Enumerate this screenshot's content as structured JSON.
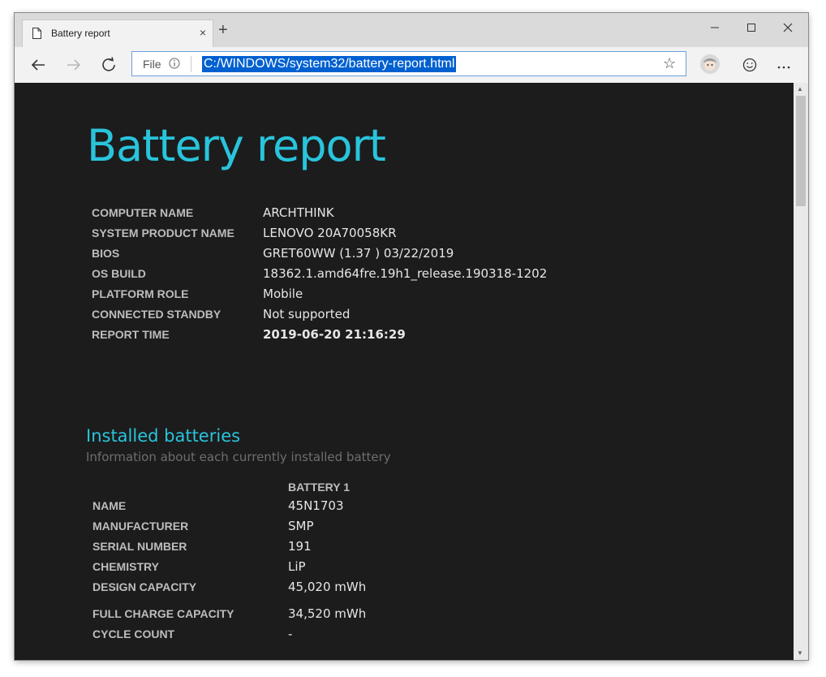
{
  "browser": {
    "tab_title": "Battery report",
    "tab_close": "×",
    "new_tab": "+",
    "address": {
      "scheme_label": "File",
      "url": "C:/WINDOWS/system32/battery-report.html"
    }
  },
  "report": {
    "title": "Battery report",
    "system_info": [
      {
        "label": "COMPUTER NAME",
        "value": "ARCHTHINK"
      },
      {
        "label": "SYSTEM PRODUCT NAME",
        "value": "LENOVO 20A70058KR"
      },
      {
        "label": "BIOS",
        "value": "GRET60WW (1.37 ) 03/22/2019"
      },
      {
        "label": "OS BUILD",
        "value": "18362.1.amd64fre.19h1_release.190318-1202"
      },
      {
        "label": "PLATFORM ROLE",
        "value": "Mobile"
      },
      {
        "label": "CONNECTED STANDBY",
        "value": "Not supported"
      },
      {
        "label": "REPORT TIME",
        "value": "2019-06-20  21:16:29"
      }
    ],
    "installed_batteries": {
      "title": "Installed batteries",
      "subtitle": "Information about each currently installed battery",
      "column_header": "BATTERY 1",
      "rows": [
        {
          "label": "NAME",
          "value": "45N1703"
        },
        {
          "label": "MANUFACTURER",
          "value": "SMP"
        },
        {
          "label": "SERIAL NUMBER",
          "value": "191"
        },
        {
          "label": "CHEMISTRY",
          "value": "LiP"
        },
        {
          "label": "DESIGN CAPACITY",
          "value": "45,020 mWh"
        },
        {
          "label": "FULL CHARGE CAPACITY",
          "value": "34,520 mWh"
        },
        {
          "label": "CYCLE COUNT",
          "value": "-"
        }
      ]
    }
  },
  "colors": {
    "accent": "#29c4dc",
    "background": "#1c1c1c",
    "label": "#bdbdbd",
    "value": "#e6e6e6"
  }
}
